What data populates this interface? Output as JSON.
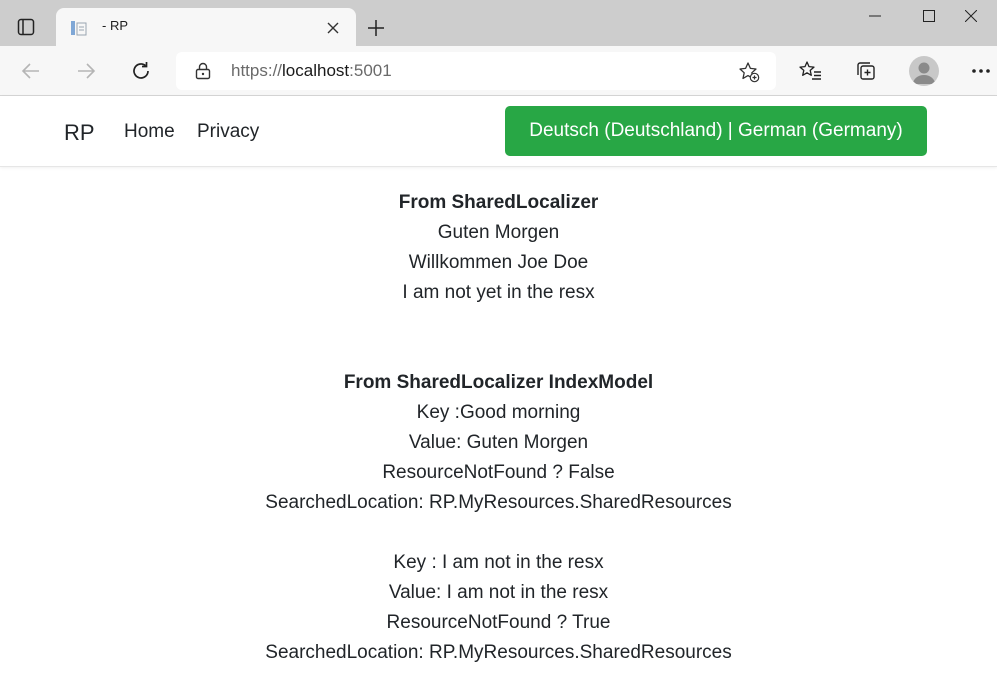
{
  "browser": {
    "tab_title": "- RP",
    "url_scheme": "https://",
    "url_host": "localhost",
    "url_port": ":5001"
  },
  "navbar": {
    "brand": "RP",
    "links": [
      "Home",
      "Privacy"
    ],
    "language_button": "Deutsch (Deutschland) | German (Germany)",
    "accent_color": "#28a745"
  },
  "content": {
    "section1": {
      "heading": "From SharedLocalizer",
      "lines": [
        "Guten Morgen",
        "Willkommen Joe Doe",
        "I am not yet in the resx"
      ]
    },
    "section2": {
      "heading": "From SharedLocalizer IndexModel",
      "block1": [
        "Key :Good morning",
        "Value: Guten Morgen",
        "ResourceNotFound ? False",
        "SearchedLocation: RP.MyResources.SharedResources"
      ],
      "block2": [
        "Key : I am not in the resx",
        "Value: I am not in the resx",
        "ResourceNotFound ? True",
        "SearchedLocation: RP.MyResources.SharedResources"
      ]
    }
  }
}
